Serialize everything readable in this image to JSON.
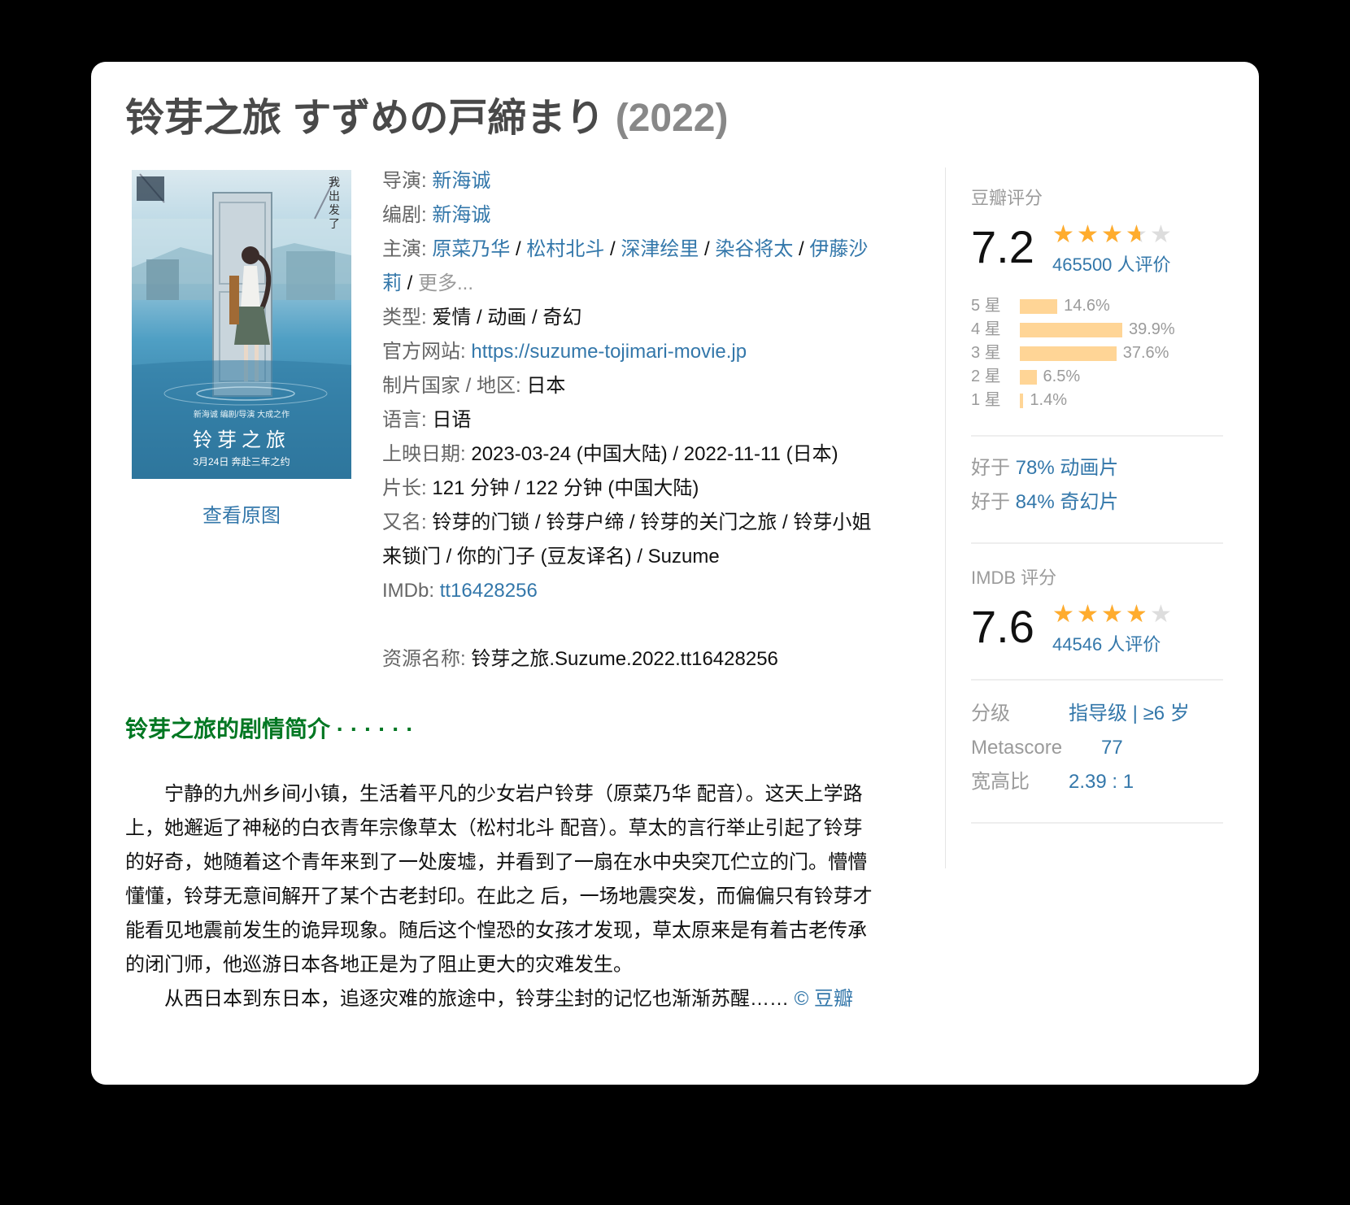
{
  "title": {
    "main": "铃芽之旅 すずめの戸締まり",
    "year": "(2022)"
  },
  "poster": {
    "vertical_text": "我出发了",
    "tagline": "新海诚 编剧/导演 大成之作",
    "title": "铃芽之旅",
    "date": "3月24日 奔赴三年之约",
    "view_original": "查看原图"
  },
  "info": {
    "director": {
      "label": "导演",
      "values": [
        "新海诚"
      ]
    },
    "writer": {
      "label": "编剧",
      "values": [
        "新海诚"
      ]
    },
    "cast": {
      "label": "主演",
      "values": [
        "原菜乃华",
        "松村北斗",
        "深津绘里",
        "染谷将太",
        "伊藤沙"
      ],
      "tail": "莉",
      "more": "更多..."
    },
    "genre": {
      "label": "类型",
      "value": "爱情 / 动画 / 奇幻"
    },
    "website": {
      "label": "官方网站",
      "value": "https://suzume-tojimari-movie.jp"
    },
    "country": {
      "label": "制片国家 / 地区",
      "value": "日本"
    },
    "language": {
      "label": "语言",
      "value": "日语"
    },
    "release": {
      "label": "上映日期",
      "value": "2023-03-24 (中国大陆) / 2022-11-11 (日本)"
    },
    "runtime": {
      "label": "片长",
      "value": "121 分钟 / 122 分钟 (中国大陆)"
    },
    "aka": {
      "label": "又名",
      "line1": "铃芽的门锁 / 铃芽户缔 / 铃芽的关门之旅 / 铃芽小姐",
      "line2": "来锁门 / 你的门子 (豆友译名) / Suzume"
    },
    "imdb": {
      "label": "IMDb",
      "value": "tt16428256"
    },
    "resource": {
      "label": "资源名称",
      "value": "铃芽之旅.Suzume.2022.tt16428256"
    }
  },
  "synopsis": {
    "heading": "铃芽之旅的剧情简介 · · · · · ·",
    "paragraph1": "宁静的九州乡间小镇，生活着平凡的少女岩户铃芽（原菜乃华 配音）。这天上学路上，她邂逅了神秘的白衣青年宗像草太（松村北斗 配音）。草太的言行举止引起了铃芽的好奇，她随着这个青年来到了一处废墟，并看到了一扇在水中央突兀伫立的门。懵懵懂懂，铃芽无意间解开了某个古老封印。在此之 后，一场地震突发，而偏偏只有铃芽才能看见地震前发生的诡异现象。随后这个惶恐的女孩才发现，草太原来是有着古老传承的闭门师，他巡游日本各地正是为了阻止更大的灾难发生。",
    "paragraph2": "从西日本到东日本，追逐灾难的旅途中，铃芽尘封的记忆也渐渐苏醒……",
    "credit": "© 豆瓣"
  },
  "douban": {
    "label": "豆瓣评分",
    "score": "7.2",
    "score_value": 7.2,
    "votes": "465500 人评价",
    "distribution": [
      {
        "label": "5 星",
        "pct": "14.6%",
        "value": 14.6
      },
      {
        "label": "4 星",
        "pct": "39.9%",
        "value": 39.9
      },
      {
        "label": "3 星",
        "pct": "37.6%",
        "value": 37.6
      },
      {
        "label": "2 星",
        "pct": "6.5%",
        "value": 6.5
      },
      {
        "label": "1 星",
        "pct": "1.4%",
        "value": 1.4
      }
    ],
    "better_than": [
      {
        "prefix": "好于",
        "value": "78% 动画片"
      },
      {
        "prefix": "好于",
        "value": "84% 奇幻片"
      }
    ]
  },
  "imdb_rating": {
    "label": "IMDB 评分",
    "score": "7.6",
    "score_value": 7.6,
    "votes": "44546 人评价"
  },
  "meta": {
    "rating_label": "分级",
    "rating_value": "指导级 | ≥6 岁",
    "metascore_label": "Metascore",
    "metascore_value": "77",
    "aspect_label": "宽高比",
    "aspect_value": "2.39 : 1"
  },
  "colors": {
    "link": "#3377aa",
    "star": "#ffac2d",
    "bar": "#ffd596",
    "synopsis_heading": "#007722"
  }
}
